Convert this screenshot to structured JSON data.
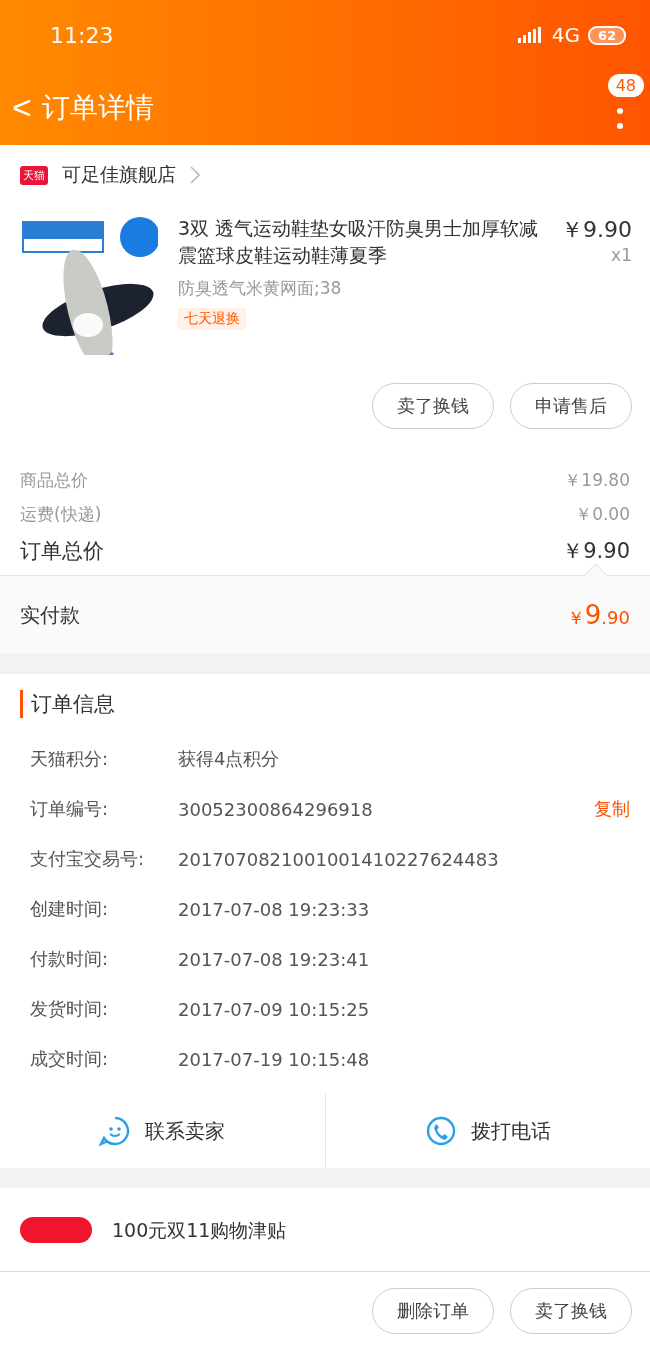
{
  "status_bar": {
    "time": "11:23",
    "network": "4G",
    "battery": "62"
  },
  "header": {
    "back": "<",
    "title": "订单详情",
    "badge": "48"
  },
  "shop": {
    "name": "可足佳旗舰店",
    "logo": "天猫"
  },
  "product": {
    "title": "3双 透气运动鞋垫女吸汗防臭男士加厚软减震篮球皮鞋运动鞋薄夏季",
    "price": "￥9.90",
    "quantity": "x1",
    "spec": "防臭透气米黄网面;38",
    "tag": "七天退换",
    "buttons": [
      "卖了换钱",
      "申请售后"
    ]
  },
  "summary": [
    {
      "label": "商品总价",
      "value": "￥19.80",
      "kind": "minor"
    },
    {
      "label": "运费(快递)",
      "value": "￥0.00",
      "kind": "minor"
    },
    {
      "label": "订单总价",
      "value": "￥9.90",
      "kind": "major"
    }
  ],
  "paid": {
    "label": "实付款",
    "currency": "￥",
    "integer": "9",
    "decimal": ".90"
  },
  "order_info": {
    "title": "订单信息",
    "rows": [
      {
        "label": "天猫积分:",
        "value": "获得4点积分"
      },
      {
        "label": "订单编号:",
        "value": "30052300864296918",
        "action": "复制"
      },
      {
        "label": "支付宝交易号:",
        "value": "2017070821001001410227624483"
      },
      {
        "label": "创建时间:",
        "value": "2017-07-08 19:23:33"
      },
      {
        "label": "付款时间:",
        "value": "2017-07-08 19:23:41"
      },
      {
        "label": "发货时间:",
        "value": "2017-07-09 10:15:25"
      },
      {
        "label": "成交时间:",
        "value": "2017-07-19 10:15:48"
      }
    ]
  },
  "contact": [
    {
      "label": "联系卖家",
      "kind": "chat"
    },
    {
      "label": "拨打电话",
      "kind": "phone"
    }
  ],
  "promo": {
    "title": "100元双11购物津贴"
  },
  "bottom_buttons": [
    "删除订单",
    "卖了换钱"
  ]
}
